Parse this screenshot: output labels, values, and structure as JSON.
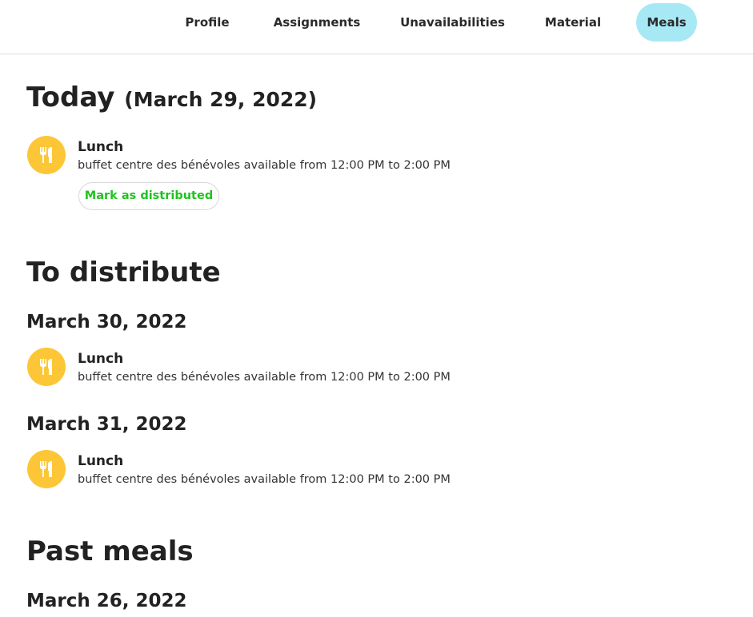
{
  "nav": {
    "tabs": [
      {
        "label": "Profile"
      },
      {
        "label": "Assignments"
      },
      {
        "label": "Unavailabilities"
      },
      {
        "label": "Material"
      },
      {
        "label": "Meals",
        "active": true
      }
    ]
  },
  "today": {
    "heading": "Today",
    "date": "(March 29, 2022)",
    "meal": {
      "icon": "utensils-icon",
      "title": "Lunch",
      "description": "buffet centre des bénévoles available from 12:00 PM to 2:00 PM",
      "action_label": "Mark as distributed"
    }
  },
  "to_distribute": {
    "heading": "To distribute",
    "days": [
      {
        "date": "March 30, 2022",
        "meal": {
          "icon": "utensils-icon",
          "title": "Lunch",
          "description": "buffet centre des bénévoles available from 12:00 PM to 2:00 PM"
        }
      },
      {
        "date": "March 31, 2022",
        "meal": {
          "icon": "utensils-icon",
          "title": "Lunch",
          "description": "buffet centre des bénévoles available from 12:00 PM to 2:00 PM"
        }
      }
    ]
  },
  "past_meals": {
    "heading": "Past meals",
    "days": [
      {
        "date": "March 26, 2022"
      }
    ]
  },
  "colors": {
    "active_tab": "#a7e8f5",
    "meal_icon_bg": "#fdc636",
    "action_text": "#1ec41e"
  }
}
